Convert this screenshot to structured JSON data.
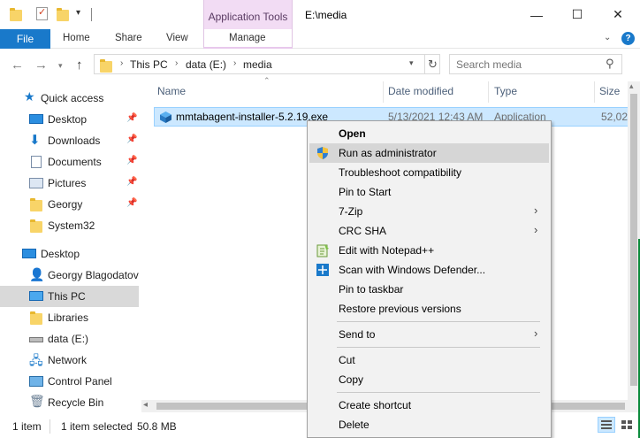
{
  "titlebar": {
    "app_tools_label": "Application Tools",
    "window_title": "E:\\media",
    "minimize": "—",
    "maximize": "☐",
    "close": "✕"
  },
  "ribbon": {
    "tabs": [
      "File",
      "Home",
      "Share",
      "View",
      "Manage"
    ]
  },
  "address": {
    "crumbs": [
      "This PC",
      "data (E:)",
      "media"
    ],
    "search_placeholder": "Search media"
  },
  "nav": {
    "quick_access": "Quick access",
    "quick_items": [
      "Desktop",
      "Downloads",
      "Documents",
      "Pictures",
      "Georgy",
      "System32"
    ],
    "tree": [
      "Desktop",
      "Georgy Blagodatov",
      "This PC",
      "Libraries",
      "data (E:)",
      "Network",
      "Control Panel",
      "Recycle Bin"
    ]
  },
  "columns": [
    "Name",
    "Date modified",
    "Type",
    "Size"
  ],
  "file": {
    "name": "mmtabagent-installer-5.2.19.exe",
    "date": "5/13/2021 12:43 AM",
    "type": "Application",
    "size": "52,02"
  },
  "status": {
    "items": "1 item",
    "selected": "1 item selected",
    "size": "50.8 MB"
  },
  "context_menu": {
    "open": "Open",
    "run_as_admin": "Run as administrator",
    "troubleshoot": "Troubleshoot compatibility",
    "pin_start": "Pin to Start",
    "sevenzip": "7-Zip",
    "crc": "CRC SHA",
    "notepad": "Edit with Notepad++",
    "defender": "Scan with Windows Defender...",
    "pin_taskbar": "Pin to taskbar",
    "restore": "Restore previous versions",
    "send_to": "Send to",
    "cut": "Cut",
    "copy": "Copy",
    "shortcut": "Create shortcut",
    "delete": "Delete"
  },
  "icons": {
    "accent": "#1979ca",
    "selection": "#cce8ff",
    "app_tools_bg": "#f2dcf4"
  }
}
